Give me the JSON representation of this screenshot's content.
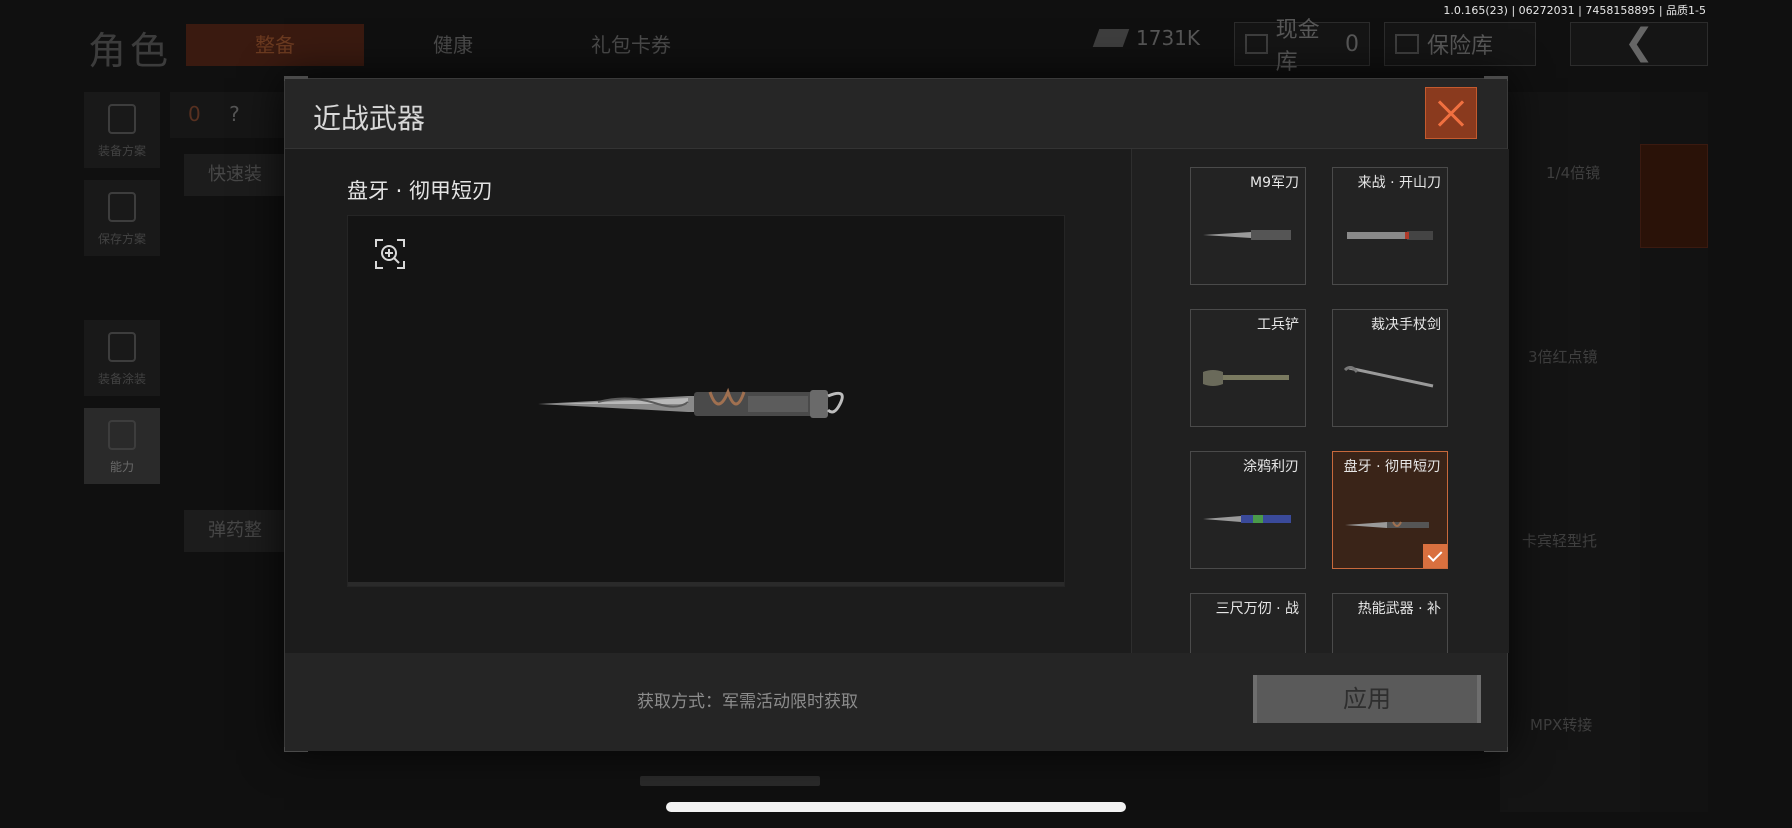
{
  "version_text": "1.0.165(23) | 06272031 | 7458158895 | 品质1-5",
  "background": {
    "title": "角色",
    "tabs": [
      "整备",
      "健康",
      "礼包卡券"
    ],
    "money": "1731K",
    "cash_vault_label": "现金库",
    "cash_vault_count": "0",
    "insurance_label": "保险库",
    "back_glyph": "❮",
    "left_nav": [
      "装备方案",
      "保存方案",
      "装备涂装",
      "能力"
    ],
    "quick_equip_label": "快速装",
    "ammo_label": "弹药整",
    "loadout_count": "0",
    "help_glyph": "?",
    "right_labels": [
      "1/4倍镜",
      "3倍红点镜",
      "卡宾轻型托",
      "MPX转接"
    ]
  },
  "modal": {
    "title": "近战武器",
    "selected_name": "盘牙 · 彻甲短刃",
    "acquire_text": "获取方式：军需活动限时获取",
    "apply_label": "应用",
    "cards": [
      {
        "label": "M9军刀",
        "weapon": "bayonet",
        "selected": false
      },
      {
        "label": "来战 · 开山刀",
        "weapon": "machete",
        "selected": false
      },
      {
        "label": "工兵铲",
        "weapon": "shovel",
        "selected": false
      },
      {
        "label": "裁决手杖剑",
        "weapon": "cane-sword",
        "selected": false
      },
      {
        "label": "涂鸦利刃",
        "weapon": "graffiti-blade",
        "selected": false
      },
      {
        "label": "盘牙 · 彻甲短刃",
        "weapon": "twisted-dagger",
        "selected": true
      },
      {
        "label": "三尺万仞 · 战",
        "weapon": "sword",
        "selected": false
      },
      {
        "label": "热能武器 · 补",
        "weapon": "thermal",
        "selected": false
      }
    ]
  },
  "colors": {
    "accent": "#d9703f",
    "close_bg": "#8a3a1e"
  },
  "icons": {
    "zoom": "zoom-in-icon",
    "close": "close-icon",
    "check": "check-icon"
  }
}
